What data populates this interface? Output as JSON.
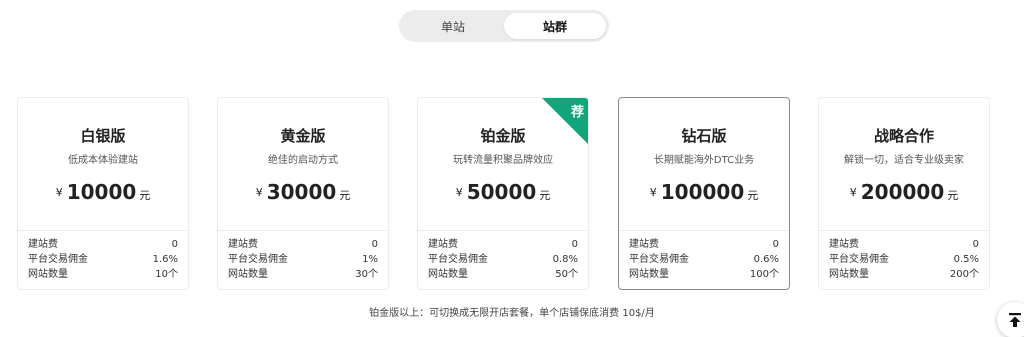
{
  "tabs": [
    {
      "label": "单站",
      "active": false
    },
    {
      "label": "站群",
      "active": true
    }
  ],
  "plans": [
    {
      "name": "白银版",
      "desc": "低成本体验建站",
      "currency": "¥",
      "price": "10000",
      "unit": "元",
      "rows": [
        {
          "label": "建站费",
          "value": "0"
        },
        {
          "label": "平台交易佣金",
          "value": "1.6%"
        },
        {
          "label": "网站数量",
          "value": "10个"
        }
      ]
    },
    {
      "name": "黄金版",
      "desc": "绝佳的启动方式",
      "currency": "¥",
      "price": "30000",
      "unit": "元",
      "rows": [
        {
          "label": "建站费",
          "value": "0"
        },
        {
          "label": "平台交易佣金",
          "value": "1%"
        },
        {
          "label": "网站数量",
          "value": "30个"
        }
      ]
    },
    {
      "name": "铂金版",
      "desc": "玩转流量积聚品牌效应",
      "currency": "¥",
      "price": "50000",
      "unit": "元",
      "badge": "荐",
      "rows": [
        {
          "label": "建站费",
          "value": "0"
        },
        {
          "label": "平台交易佣金",
          "value": "0.8%"
        },
        {
          "label": "网站数量",
          "value": "50个"
        }
      ]
    },
    {
      "name": "钻石版",
      "desc": "长期赋能海外DTC业务",
      "currency": "¥",
      "price": "100000",
      "unit": "元",
      "selected": true,
      "rows": [
        {
          "label": "建站费",
          "value": "0"
        },
        {
          "label": "平台交易佣金",
          "value": "0.6%"
        },
        {
          "label": "网站数量",
          "value": "100个"
        }
      ]
    },
    {
      "name": "战略合作",
      "desc": "解锁一切，适合专业级卖家",
      "currency": "¥",
      "price": "200000",
      "unit": "元",
      "rows": [
        {
          "label": "建站费",
          "value": "0"
        },
        {
          "label": "平台交易佣金",
          "value": "0.5%"
        },
        {
          "label": "网站数量",
          "value": "200个"
        }
      ]
    }
  ],
  "footnote": "铂金版以上：可切换成无限开店套餐，单个店铺保底消费 10$/月",
  "colors": {
    "badge": "#12a47a",
    "toggle_bg": "#ececec",
    "selected_border": "#8a8a8a"
  },
  "icons": {
    "back_to_top": "arrow-up-to-line-icon"
  }
}
